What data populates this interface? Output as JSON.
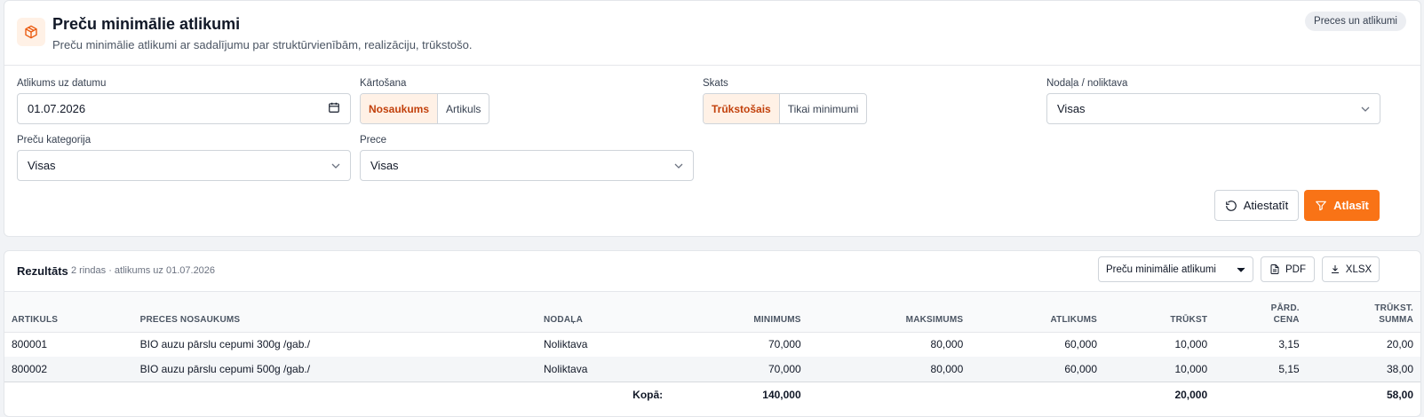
{
  "header": {
    "title": "Preču minimālie atlikumi",
    "subtitle": "Preču minimālie atlikumi ar sadalījumu par struktūrvienībām, realizāciju, trūkstošo.",
    "badge": "Preces un atlikumi",
    "icon": "box-icon"
  },
  "filters": {
    "date_label": "Atlikums uz datumu",
    "date_value": "01.07.2026",
    "sort_label": "Kārtošana",
    "sort_options": [
      "Nosaukums",
      "Artikuls"
    ],
    "view_label": "Skats",
    "view_options": [
      "Trūkstošais",
      "Tikai minimumi"
    ],
    "dept_label": "Nodaļa / noliktava",
    "dept_value": "Visas",
    "category_label": "Preču kategorija",
    "category_value": "Visas",
    "product_label": "Prece",
    "product_value": "Visas",
    "reset_label": "Atiestatīt",
    "apply_label": "Atlasīt"
  },
  "results": {
    "title": "Rezultāts",
    "meta": "2 rindas · atlikums uz 01.07.2026",
    "report_select": "Preču minimālie atlikumi",
    "pdf_label": "PDF",
    "xlsx_label": "XLSX",
    "columns": [
      "Artikuls",
      "Preces nosaukums",
      "Nodaļa",
      "Minimums",
      "Maksimums",
      "Atlikums",
      "Trūkst",
      "Pārd. cena",
      "Trūkst. summa"
    ],
    "rows": [
      [
        "800001",
        "BIO auzu pārslu cepumi 300g /gab./",
        "Noliktava",
        "70,000",
        "80,000",
        "60,000",
        "10,000",
        "3,15",
        "20,00"
      ],
      [
        "800002",
        "BIO auzu pārslu cepumi 500g /gab./",
        "Noliktava",
        "70,000",
        "80,000",
        "60,000",
        "10,000",
        "5,15",
        "38,00"
      ]
    ],
    "total": {
      "label": "Kopā:",
      "minimums": "140,000",
      "trukst": "20,000",
      "summa": "58,00"
    }
  },
  "colors": {
    "accent": "#f97316",
    "accent_bg": "#fff1e6"
  }
}
